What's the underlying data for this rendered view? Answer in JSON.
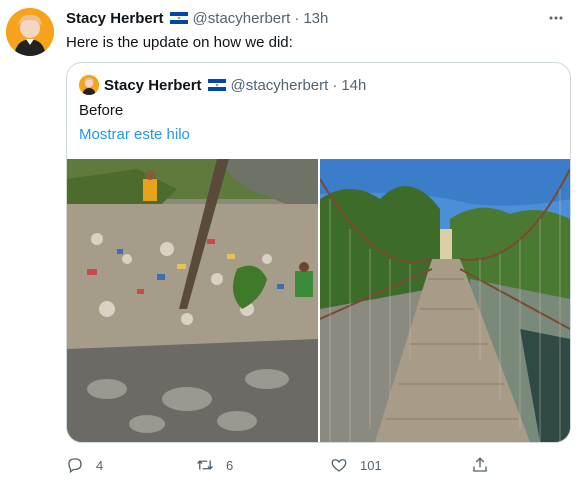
{
  "author": {
    "name": "Stacy Herbert",
    "handle": "@stacyherbert",
    "time": "13h",
    "avatar_icon": "profile-avatar",
    "flag_icon": "el-salvador-flag"
  },
  "tweet": {
    "text": "Here is the update on how we did:"
  },
  "quoted": {
    "name": "Stacy Herbert",
    "handle": "@stacyherbert",
    "time": "14h",
    "text": "Before",
    "show_thread": "Mostrar este hilo",
    "media": [
      "trash-riverbank-photo",
      "suspension-bridge-photo"
    ]
  },
  "actions": {
    "replies": "4",
    "retweets": "6",
    "likes": "101"
  },
  "separator": "·",
  "colors": {
    "link": "#1d9bf0",
    "muted": "#536471",
    "border": "#cfd9de"
  }
}
